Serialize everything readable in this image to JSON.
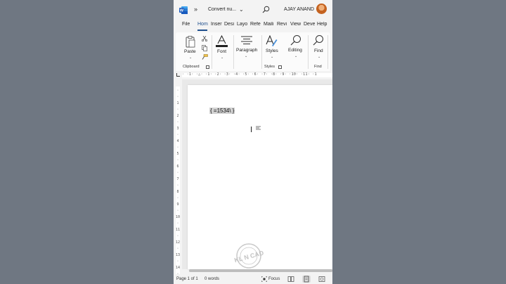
{
  "titlebar": {
    "more_label": "»",
    "doc_title": "Convert nu...",
    "chevron": "⌄",
    "user_name": "AJAY ANAND"
  },
  "tabs": [
    "File",
    "Hom",
    "Inser",
    "Desi",
    "Layo",
    "Refe",
    "Maili",
    "Revi",
    "View",
    "Deve",
    "Help"
  ],
  "active_tab": "Hom",
  "ribbon": {
    "paste": "Paste",
    "font": "Font",
    "paragraph": "Paragraph",
    "styles": "Styles",
    "editing": "Editing",
    "find": "Find",
    "group_clipboard": "Clipboard",
    "group_styles": "Styles",
    "group_find": "Find"
  },
  "document": {
    "field_code": "{ =1534\\ }"
  },
  "statusbar": {
    "page": "Page 1 of 1",
    "words": "0 words",
    "focus": "Focus"
  },
  "colors": {
    "accent": "#1e4e8c",
    "word_blue": "#185abd",
    "backdrop": "#6f7782"
  }
}
